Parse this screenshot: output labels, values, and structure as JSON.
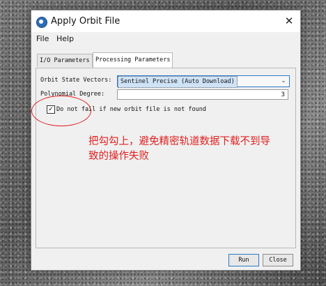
{
  "window": {
    "title": "Apply Orbit File",
    "close_glyph": "✕"
  },
  "menu": {
    "file": "File",
    "help": "Help"
  },
  "tabs": [
    {
      "label": "I/O Parameters",
      "active": false
    },
    {
      "label": "Processing Parameters",
      "active": true
    }
  ],
  "form": {
    "orbit_label": "Orbit State Vectors:",
    "orbit_value": "Sentinel Precise (Auto Download)",
    "poly_label": "Polynomial Degree:",
    "poly_value": "3",
    "checkbox_label": "Do not fail if new orbit file is not found",
    "checkbox_checked": true,
    "checkbox_glyph": "✓"
  },
  "annotation": {
    "text": "把勾勾上，避免精密轨道数据下载不到导致的操作失败",
    "color": "#e02020"
  },
  "buttons": {
    "run": "Run",
    "close": "Close"
  }
}
